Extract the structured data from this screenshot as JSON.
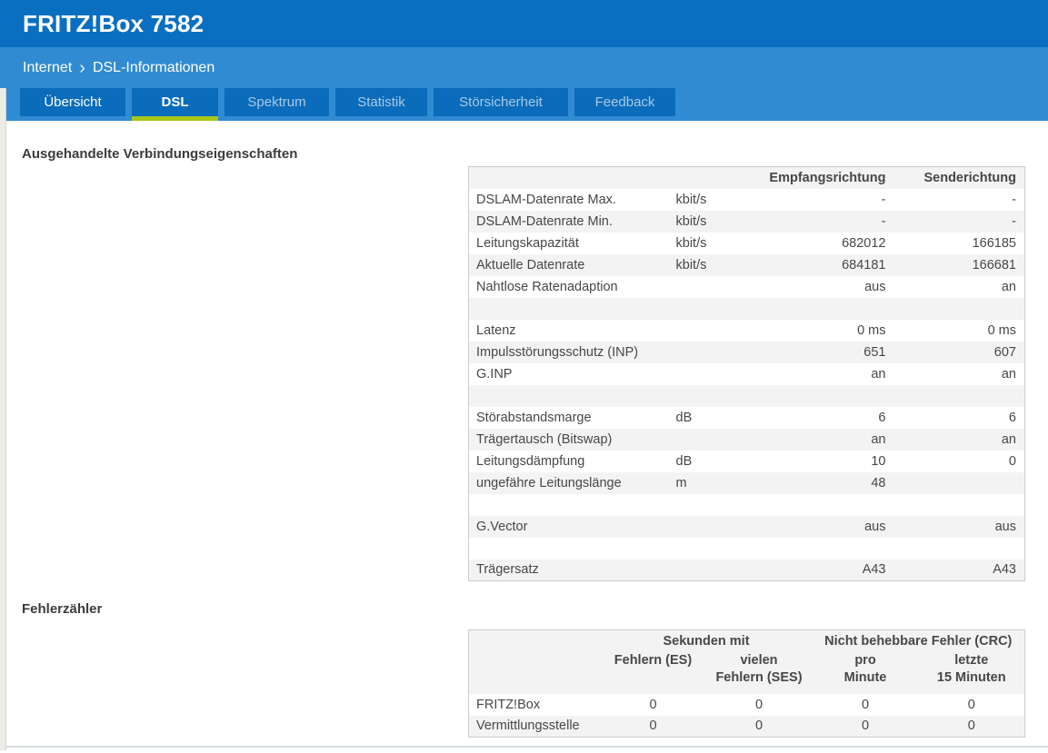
{
  "header": {
    "title": "FRITZ!Box 7582"
  },
  "breadcrumb": {
    "section": "Internet",
    "separator": "›",
    "page": "DSL-Informationen"
  },
  "tabs": [
    {
      "label": "Übersicht",
      "active": false
    },
    {
      "label": "DSL",
      "active": true
    },
    {
      "label": "Spektrum",
      "active": false
    },
    {
      "label": "Statistik",
      "active": false
    },
    {
      "label": "Störsicherheit",
      "active": false
    },
    {
      "label": "Feedback",
      "active": false
    }
  ],
  "connection": {
    "title": "Ausgehandelte Verbindungseigenschaften",
    "columns": {
      "rx": "Empfangsrichtung",
      "tx": "Senderichtung"
    },
    "rows": [
      {
        "label": "DSLAM-Datenrate Max.",
        "unit": "kbit/s",
        "rx": "-",
        "tx": "-"
      },
      {
        "label": "DSLAM-Datenrate Min.",
        "unit": "kbit/s",
        "rx": "-",
        "tx": "-"
      },
      {
        "label": "Leitungskapazität",
        "unit": "kbit/s",
        "rx": "682012",
        "tx": "166185"
      },
      {
        "label": "Aktuelle Datenrate",
        "unit": "kbit/s",
        "rx": "684181",
        "tx": "166681"
      },
      {
        "label": "Nahtlose Ratenadaption",
        "unit": "",
        "rx": "aus",
        "tx": "an"
      },
      {
        "label": "",
        "unit": "",
        "rx": "",
        "tx": ""
      },
      {
        "label": "Latenz",
        "unit": "",
        "rx": "0 ms",
        "tx": "0 ms"
      },
      {
        "label": "Impulsstörungsschutz (INP)",
        "unit": "",
        "rx": "651",
        "tx": "607"
      },
      {
        "label": "G.INP",
        "unit": "",
        "rx": "an",
        "tx": "an"
      },
      {
        "label": "",
        "unit": "",
        "rx": "",
        "tx": ""
      },
      {
        "label": "Störabstandsmarge",
        "unit": "dB",
        "rx": "6",
        "tx": "6"
      },
      {
        "label": "Trägertausch (Bitswap)",
        "unit": "",
        "rx": "an",
        "tx": "an"
      },
      {
        "label": "Leitungsdämpfung",
        "unit": "dB",
        "rx": "10",
        "tx": "0"
      },
      {
        "label": "ungefähre Leitungslänge",
        "unit": "m",
        "rx": "48",
        "tx": ""
      },
      {
        "label": "",
        "unit": "",
        "rx": "",
        "tx": ""
      },
      {
        "label": "G.Vector",
        "unit": "",
        "rx": "aus",
        "tx": "aus"
      },
      {
        "label": "",
        "unit": "",
        "rx": "",
        "tx": ""
      },
      {
        "label": "Trägersatz",
        "unit": "",
        "rx": "A43",
        "tx": "A43"
      }
    ]
  },
  "errors": {
    "title": "Fehlerzähler",
    "group_headers": [
      "Sekunden mit",
      "Nicht behebbare Fehler (CRC)"
    ],
    "columns": [
      "Fehlern (ES)",
      "vielen\nFehlern (SES)",
      "pro\nMinute",
      "letzte\n15 Minuten"
    ],
    "rows": [
      {
        "label": "FRITZ!Box",
        "values": [
          "0",
          "0",
          "0",
          "0"
        ]
      },
      {
        "label": "Vermittlungsstelle",
        "values": [
          "0",
          "0",
          "0",
          "0"
        ]
      }
    ]
  },
  "colors": {
    "header_bg": "#0a6fc0",
    "band_bg": "#318bd2",
    "tab_bg": "#0a6cba",
    "active_tab_underline": "#a8c617",
    "row_stripe": "#f3f3f3"
  }
}
